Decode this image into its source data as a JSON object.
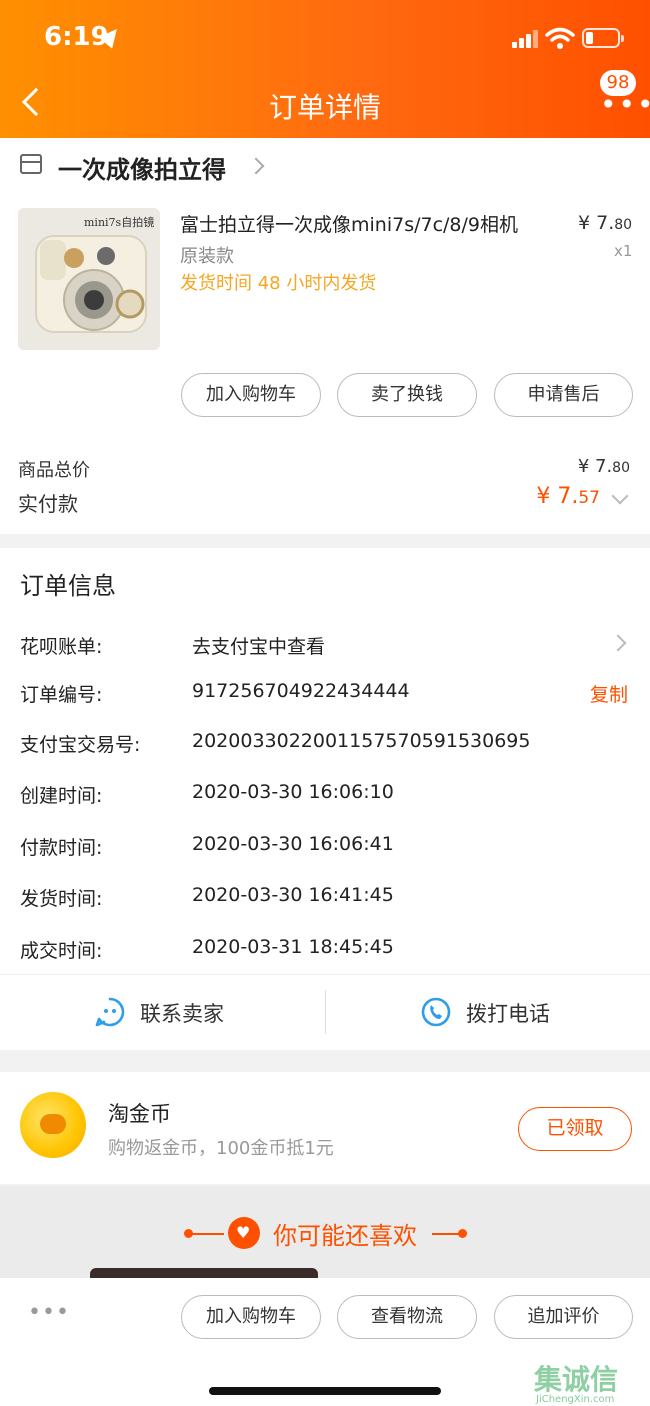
{
  "status_bar": {
    "time": "6:19"
  },
  "nav": {
    "title": "订单详情",
    "badge": "98"
  },
  "shop": {
    "name": "一次成像拍立得"
  },
  "product": {
    "image_label": "mini7s自拍镜",
    "title": "富士拍立得一次成像mini7s/7c/8/9相机",
    "price_int": "¥ 7.",
    "price_dec": "80",
    "spec": "原装款",
    "quantity": "x1",
    "shipping": "发货时间  48 小时内发货"
  },
  "item_actions": [
    "加入购物车",
    "卖了换钱",
    "申请售后"
  ],
  "summary": {
    "goods_total_label": "商品总价",
    "goods_total_int": "¥ 7.",
    "goods_total_dec": "80",
    "paid_label": "实付款",
    "paid_int": "¥ 7.",
    "paid_dec": "57"
  },
  "order_info": {
    "title": "订单信息",
    "rows": [
      {
        "label": "花呗账单:",
        "value": "去支付宝中查看"
      },
      {
        "label": "订单编号:",
        "value": "917256704922434444"
      },
      {
        "label": "支付宝交易号:",
        "value": "2020033022001157570591530695"
      },
      {
        "label": "创建时间:",
        "value": "2020-03-30 16:06:10"
      },
      {
        "label": "付款时间:",
        "value": "2020-03-30 16:06:41"
      },
      {
        "label": "发货时间:",
        "value": "2020-03-30 16:41:45"
      },
      {
        "label": "成交时间:",
        "value": "2020-03-31 18:45:45"
      }
    ],
    "copy_label": "复制"
  },
  "contact": {
    "seller": "联系卖家",
    "phone": "拨打电话"
  },
  "coin": {
    "title": "淘金币",
    "subtitle": "购物返金币，100金币抵1元",
    "button": "已领取"
  },
  "recommend": {
    "title": "你可能还喜欢"
  },
  "bottom_actions": [
    "加入购物车",
    "查看物流",
    "追加评价"
  ],
  "watermark": {
    "big": "集诚信",
    "small": "JiChengXin.com"
  },
  "colors": {
    "accent": "#ff5000",
    "ship_orange": "#f5a623",
    "header_start": "#ff9000"
  }
}
